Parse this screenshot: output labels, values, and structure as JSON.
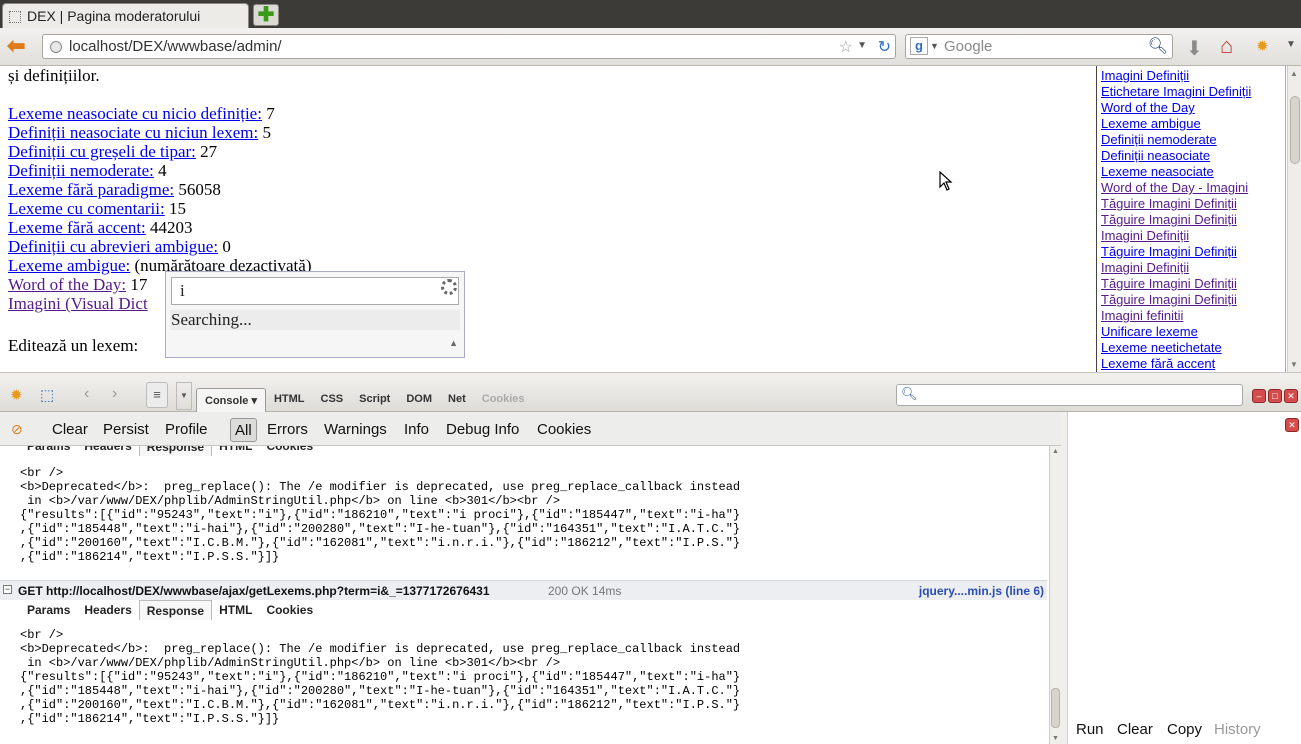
{
  "browser": {
    "tab_title": "DEX | Pagina moderatorului",
    "new_tab_symbol": "✚",
    "url": "localhost/DEX/wwwbase/admin/",
    "search_placeholder": "Google",
    "search_engine_letter": "g"
  },
  "page": {
    "intro_text": "și definițiilor.",
    "stats": [
      {
        "label": "Lexeme neasociate cu nicio definiție:",
        "value": " 7",
        "visited": false
      },
      {
        "label": "Definiții neasociate cu niciun lexem:",
        "value": " 5",
        "visited": false
      },
      {
        "label": "Definiții cu greșeli de tipar:",
        "value": " 27",
        "visited": false
      },
      {
        "label": "Definiții nemoderate:",
        "value": " 4",
        "visited": false
      },
      {
        "label": "Lexeme fără paradigme:",
        "value": " 56058",
        "visited": false
      },
      {
        "label": "Lexeme cu comentarii:",
        "value": " 15",
        "visited": false
      },
      {
        "label": "Lexeme fără accent:",
        "value": " 44203",
        "visited": false
      },
      {
        "label": "Definiții cu abrevieri ambigue:",
        "value": " 0",
        "visited": false
      },
      {
        "label": "Lexeme ambigue:",
        "value": " (numărătoare dezactivată)",
        "visited": false
      },
      {
        "label": "Word of the Day:",
        "value": " 17",
        "visited": true
      },
      {
        "label": "Imagini (Visual Dict",
        "value": "",
        "visited": true
      }
    ],
    "edit_label": "Editează un lexem:",
    "autocomplete": {
      "input_value": "i",
      "status_text": "Searching..."
    }
  },
  "sidebar": {
    "links": [
      {
        "label": "Imagini Definiții",
        "visited": false
      },
      {
        "label": "Etichetare Imagini Definiții",
        "visited": false
      },
      {
        "label": "Word of the Day",
        "visited": false
      },
      {
        "label": "Lexeme ambigue",
        "visited": false
      },
      {
        "label": "Definiții nemoderate",
        "visited": false
      },
      {
        "label": "Definiții neasociate",
        "visited": false
      },
      {
        "label": "Lexeme neasociate",
        "visited": false
      },
      {
        "label": "Word of the Day - Imagini",
        "visited": true
      },
      {
        "label": "Tăguire Imagini Definiții",
        "visited": true
      },
      {
        "label": "Tăguire Imagini Definiții",
        "visited": true
      },
      {
        "label": "Imagini Definiții",
        "visited": true
      },
      {
        "label": "Tăguire Imagini Definiții",
        "visited": false
      },
      {
        "label": "Imagini Definiții",
        "visited": true
      },
      {
        "label": "Tăguire Imagini Definiții",
        "visited": true
      },
      {
        "label": "Tăguire Imagini Definiții",
        "visited": true
      },
      {
        "label": "Imagini fefinitii",
        "visited": true
      },
      {
        "label": "Unificare lexeme",
        "visited": false
      },
      {
        "label": "Lexeme neetichetate",
        "visited": false
      },
      {
        "label": "Lexeme fără accent",
        "visited": false
      }
    ]
  },
  "firebug": {
    "toolbar_tabs": [
      {
        "label": "Console ▾",
        "active": true,
        "disabled": false
      },
      {
        "label": "HTML",
        "active": false,
        "disabled": false
      },
      {
        "label": "CSS",
        "active": false,
        "disabled": false
      },
      {
        "label": "Script",
        "active": false,
        "disabled": false
      },
      {
        "label": "DOM",
        "active": false,
        "disabled": false
      },
      {
        "label": "Net",
        "active": false,
        "disabled": false
      },
      {
        "label": "Cookies",
        "active": false,
        "disabled": true
      }
    ],
    "search_value": "",
    "console_buttons": [
      {
        "label": "Clear",
        "active": false
      },
      {
        "label": "Persist",
        "active": false
      },
      {
        "label": "Profile",
        "active": false
      },
      {
        "label": "All",
        "active": true
      },
      {
        "label": "Errors",
        "active": false
      },
      {
        "label": "Warnings",
        "active": false
      },
      {
        "label": "Info",
        "active": false
      },
      {
        "label": "Debug Info",
        "active": false
      },
      {
        "label": "Cookies",
        "active": false
      }
    ],
    "response_tabs": [
      "Params",
      "Headers",
      "Response",
      "HTML",
      "Cookies"
    ],
    "response_text": "<br />\n<b>Deprecated</b>:  preg_replace(): The /e modifier is deprecated, use preg_replace_callback instead\n in <b>/var/www/DEX/phplib/AdminStringUtil.php</b> on line <b>301</b><br />\n{\"results\":[{\"id\":\"95243\",\"text\":\"i\"},{\"id\":\"186210\",\"text\":\"i proci\"},{\"id\":\"185447\",\"text\":\"i-ha\"}\n,{\"id\":\"185448\",\"text\":\"i-hai\"},{\"id\":\"200280\",\"text\":\"I-he-tuan\"},{\"id\":\"164351\",\"text\":\"I.A.T.C.\"}\n,{\"id\":\"200160\",\"text\":\"I.C.B.M.\"},{\"id\":\"162081\",\"text\":\"i.n.r.i.\"},{\"id\":\"186212\",\"text\":\"I.P.S.\"}\n,{\"id\":\"186214\",\"text\":\"I.P.S.S.\"}]}",
    "request": {
      "toggle": "−",
      "url": "GET http://localhost/DEX/wwwbase/ajax/getLexems.php?term=i&_=1377172676431",
      "status": "200 OK 14ms",
      "source": "jquery....min.js (line 6)"
    },
    "command_actions": [
      {
        "label": "Run",
        "disabled": false
      },
      {
        "label": "Clear",
        "disabled": false
      },
      {
        "label": "Copy",
        "disabled": false
      },
      {
        "label": "History",
        "disabled": true
      }
    ]
  }
}
